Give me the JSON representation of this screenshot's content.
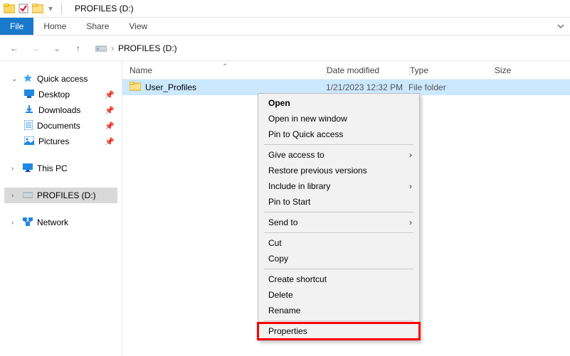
{
  "window": {
    "title": "PROFILES (D:)"
  },
  "qat": {
    "check_icon": "check-icon",
    "folder_icon": "folder-icon"
  },
  "ribbon": {
    "file": "File",
    "home": "Home",
    "share": "Share",
    "view": "View"
  },
  "nav": {
    "back": "←",
    "forward": "→",
    "up": "↑",
    "down": "⌄"
  },
  "breadcrumb": {
    "root_icon": "drive-icon",
    "item1": "PROFILES (D:)"
  },
  "sidebar": {
    "quick_access": "Quick access",
    "desktop": "Desktop",
    "downloads": "Downloads",
    "documents": "Documents",
    "pictures": "Pictures",
    "this_pc": "This PC",
    "profiles_drive": "PROFILES (D:)",
    "network": "Network"
  },
  "columns": {
    "name": "Name",
    "date": "Date modified",
    "type": "Type",
    "size": "Size"
  },
  "rows": [
    {
      "name": "User_Profiles",
      "date": "1/21/2023 12:32 PM",
      "type": "File folder",
      "size": ""
    }
  ],
  "context_menu": {
    "open": "Open",
    "open_new": "Open in new window",
    "pin_qa": "Pin to Quick access",
    "give_access": "Give access to",
    "restore_prev": "Restore previous versions",
    "include_lib": "Include in library",
    "pin_start": "Pin to Start",
    "send_to": "Send to",
    "cut": "Cut",
    "copy": "Copy",
    "create_shortcut": "Create shortcut",
    "delete": "Delete",
    "rename": "Rename",
    "properties": "Properties"
  }
}
